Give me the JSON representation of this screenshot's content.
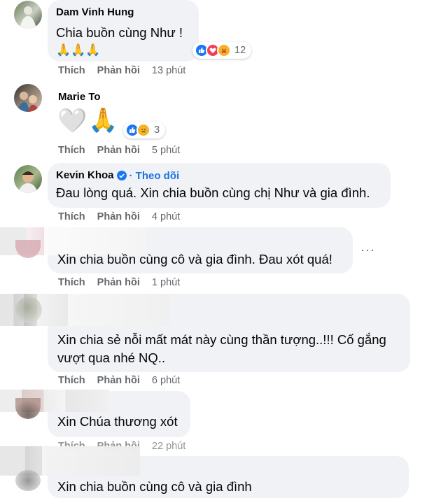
{
  "actions": {
    "like": "Thích",
    "reply": "Phản hồi"
  },
  "comments": [
    {
      "author": "Dam Vinh Hung",
      "text": "Chia buồn cùng Như !",
      "emoji": "🙏🙏🙏",
      "reaction_count": "12",
      "time": "13 phút",
      "reaction_icons": [
        "like-icon",
        "love-icon",
        "care-icon"
      ]
    },
    {
      "author": "Marie To",
      "text": "",
      "emoji_heart": "🤍",
      "emoji_pray": "🙏",
      "reaction_count": "3",
      "time": "5 phút",
      "reaction_icons": [
        "like-icon",
        "sad-icon"
      ]
    },
    {
      "author": "Kevin Khoa",
      "follow_label": "· Theo dõi",
      "text": "Đau lòng quá. Xin chia buồn cùng chị Như và gia đình.",
      "time": "4 phút"
    },
    {
      "author": "",
      "text": "Xin chia buồn cùng cô và gia đình. Đau xót quá!",
      "time": "1 phút",
      "more": "···"
    },
    {
      "author": "",
      "text_line1": "Xin chia sẻ nỗi mất mát này cùng thần tượng..!!! Cố gắng",
      "text_line2": "vượt qua nhé NQ..",
      "time": "6 phút"
    },
    {
      "author": "",
      "text": "Xin Chúa thương xót",
      "time": "22 phút"
    },
    {
      "author": "",
      "text": "Xin chia buồn cùng cô và gia đình"
    }
  ],
  "colors": {
    "bubble": "#f0f2f5",
    "meta": "#65676b",
    "follow": "#1b74e4",
    "like": "#1877f2",
    "love": "#f33e58",
    "care": "#f7b125"
  }
}
